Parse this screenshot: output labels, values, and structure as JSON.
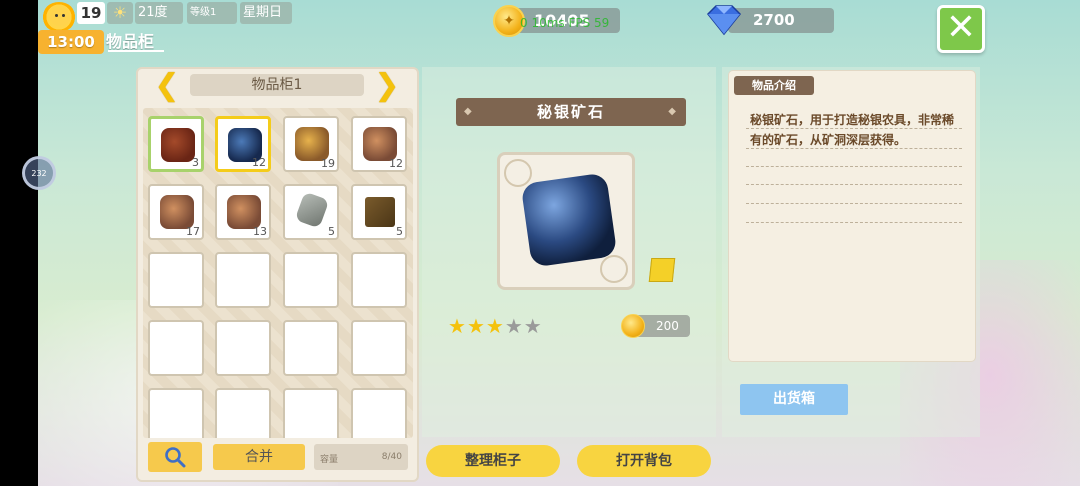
{
  "status": {
    "day": "19",
    "time": "13:00",
    "weather_icon": "sun-icon",
    "temperature": "21度",
    "eco_label": "等级1",
    "weekday": "星期日",
    "page_title": "物品柜"
  },
  "currency": {
    "coins": "10405",
    "fps_overlay": "0 10ms  FPS 59",
    "gems": "2700"
  },
  "cabinet": {
    "name": "物品柜1",
    "prev_arrow": "❮",
    "next_arrow": "❯",
    "slots": [
      {
        "item": "dark-red-ore",
        "count": "3"
      },
      {
        "item": "mithril-ore",
        "count": "12"
      },
      {
        "item": "gold-ore",
        "count": "19"
      },
      {
        "item": "copper-ore",
        "count": "12"
      },
      {
        "item": "copper-ore",
        "count": "17"
      },
      {
        "item": "copper-ore",
        "count": "13"
      },
      {
        "item": "stone",
        "count": "5"
      },
      {
        "item": "wood-block",
        "count": "5"
      }
    ],
    "merge_label": "合并",
    "capacity_label": "容量",
    "capacity_value": "8/40"
  },
  "detail": {
    "item_name": "秘银矿石",
    "stars_filled": 3,
    "stars_total": 5,
    "price": "200",
    "sort_label": "整理柜子",
    "open_bag_label": "打开背包"
  },
  "description": {
    "tag": "物品介绍",
    "text": "秘银矿石，用于打造秘银农具，非常稀有的矿石，从矿洞深层获得。",
    "ship_label": "出货箱"
  },
  "colors": {
    "accent_yellow": "#f8d440",
    "banner_brown": "#7e6550",
    "close_green": "#7ec84a",
    "ship_blue": "#8ec5f0"
  }
}
